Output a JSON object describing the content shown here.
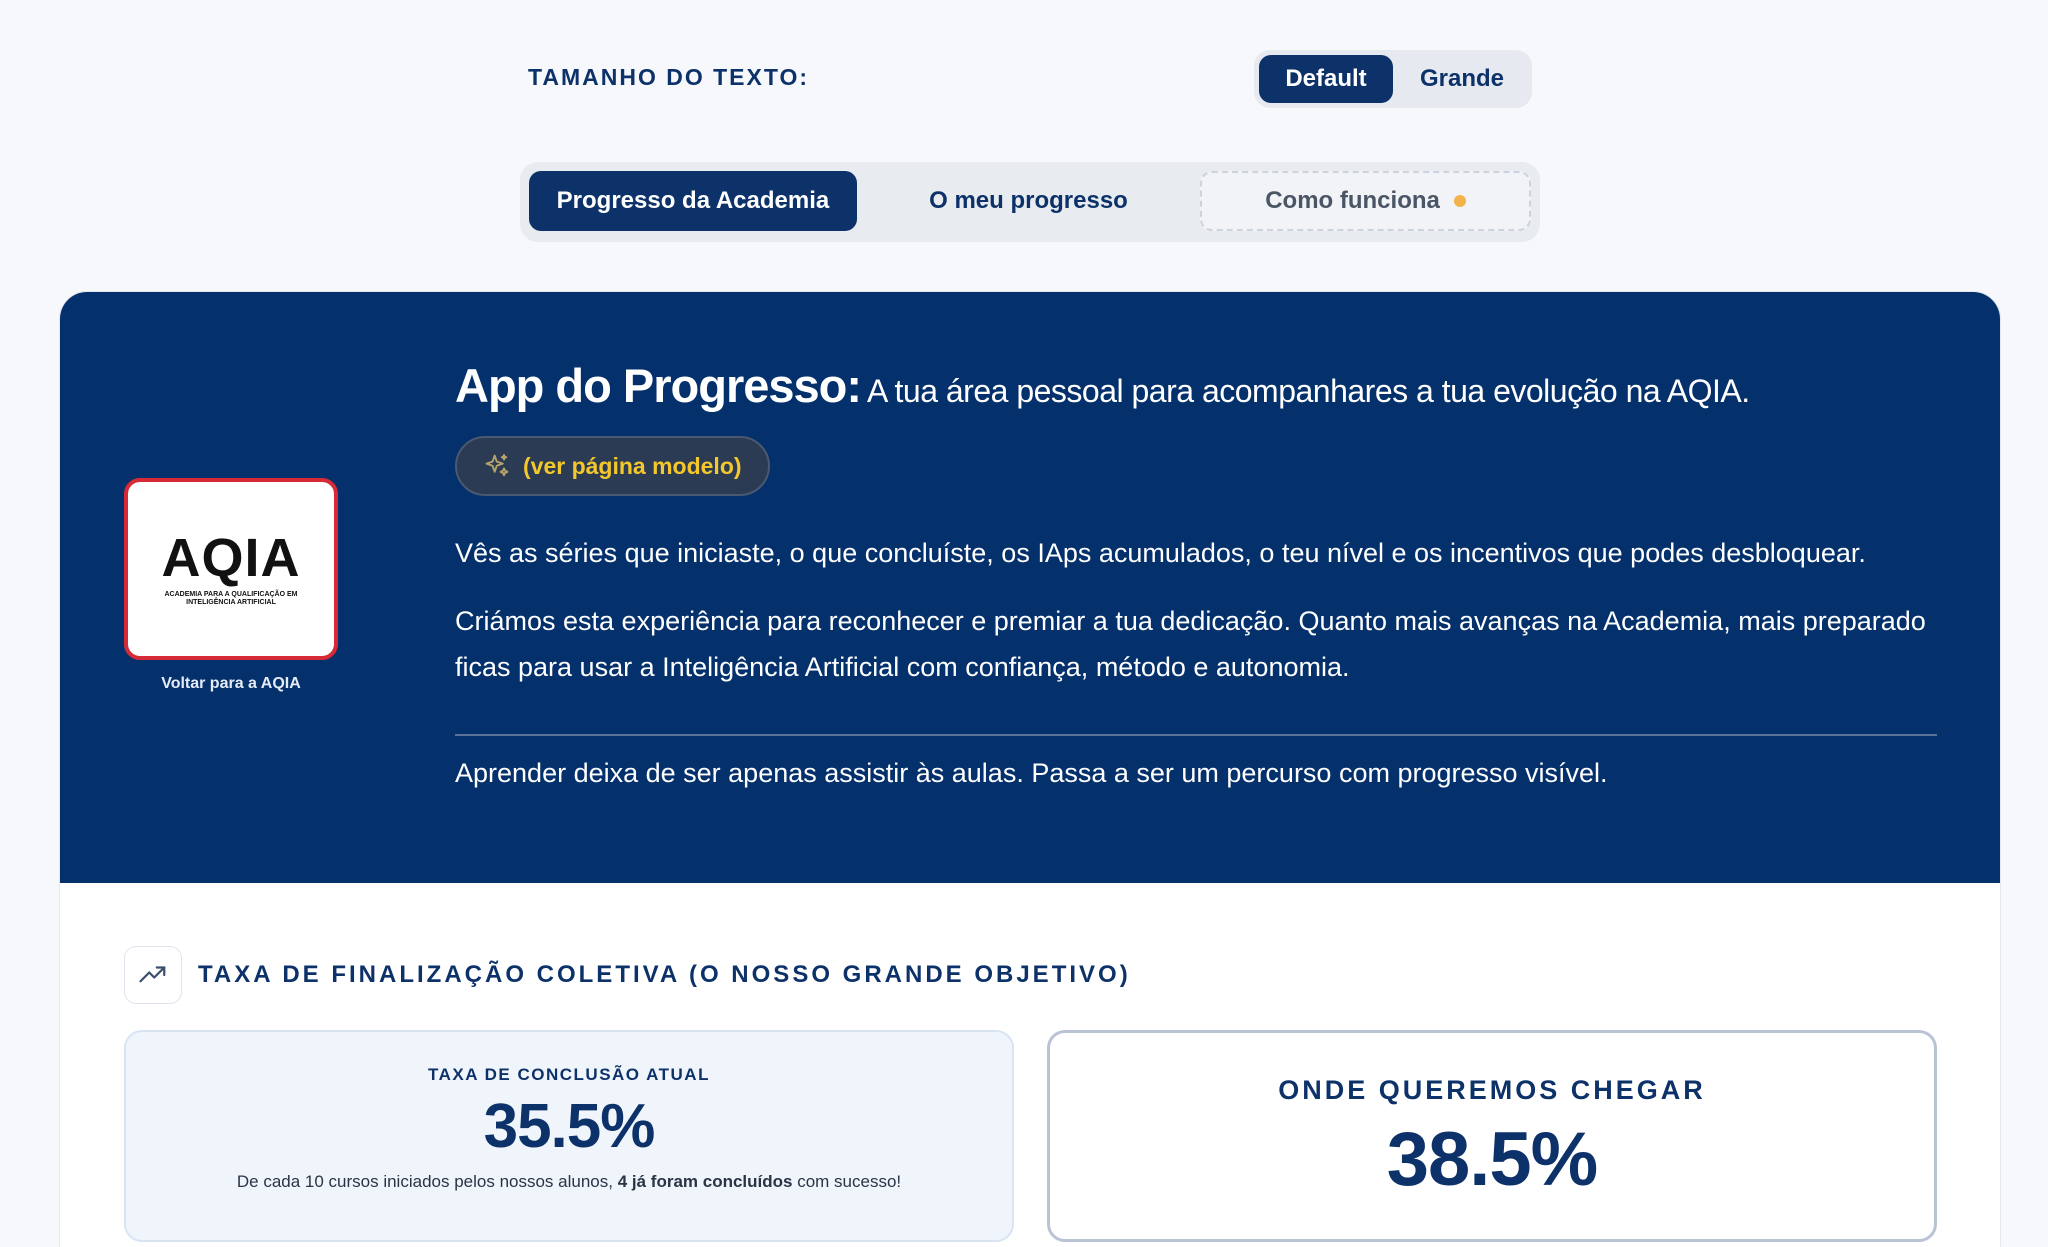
{
  "text_size": {
    "label": "TAMANHO DO TEXTO:",
    "options": [
      "Default",
      "Grande"
    ],
    "selected": "Default"
  },
  "tabs": [
    {
      "label": "Progresso da Academia",
      "active": true
    },
    {
      "label": "O meu progresso",
      "active": false
    },
    {
      "label": "Como funciona",
      "active": false
    }
  ],
  "hero": {
    "logo_text": "AQIA",
    "logo_subtitle": "ACADEMIA PARA A QUALIFICAÇÃO EM INTELIGÊNCIA ARTIFICIAL",
    "back_link": "Voltar para a AQIA",
    "title_strong": "App do Progresso:",
    "title_rest": "A tua área pessoal para acompanhares a tua evolução na AQIA.",
    "model_button": "(ver página modelo)",
    "paragraph_1": "Vês as séries que iniciaste, o que concluíste, os IAps acumulados, o teu nível e os incentivos que podes desbloquear.",
    "paragraph_2": "Criámos esta experiência para reconhecer e premiar a tua dedicação. Quanto mais avanças na Academia, mais preparado ficas para usar a Inteligência Artificial com confiança, método e autonomia.",
    "paragraph_3": "Aprender deixa de ser apenas assistir às aulas. Passa a ser um percurso com progresso visível."
  },
  "section": {
    "title": "TAXA DE FINALIZAÇÃO COLETIVA (O NOSSO GRANDE OBJETIVO)",
    "icon": "trending-up-icon"
  },
  "current_rate": {
    "label": "TAXA DE CONCLUSÃO ATUAL",
    "value": "35.5%",
    "desc_pre": "De cada 10 cursos iniciados pelos nossos alunos, ",
    "desc_bold": "4 já foram concluídos",
    "desc_post": " com sucesso!"
  },
  "target_rate": {
    "label": "ONDE QUEREMOS CHEGAR",
    "value": "38.5%"
  },
  "colors": {
    "brand_navy": "#04306c",
    "accent_yellow": "#f4c72b",
    "logo_border_red": "#d62a36",
    "dot_orange": "#f2b34a"
  }
}
